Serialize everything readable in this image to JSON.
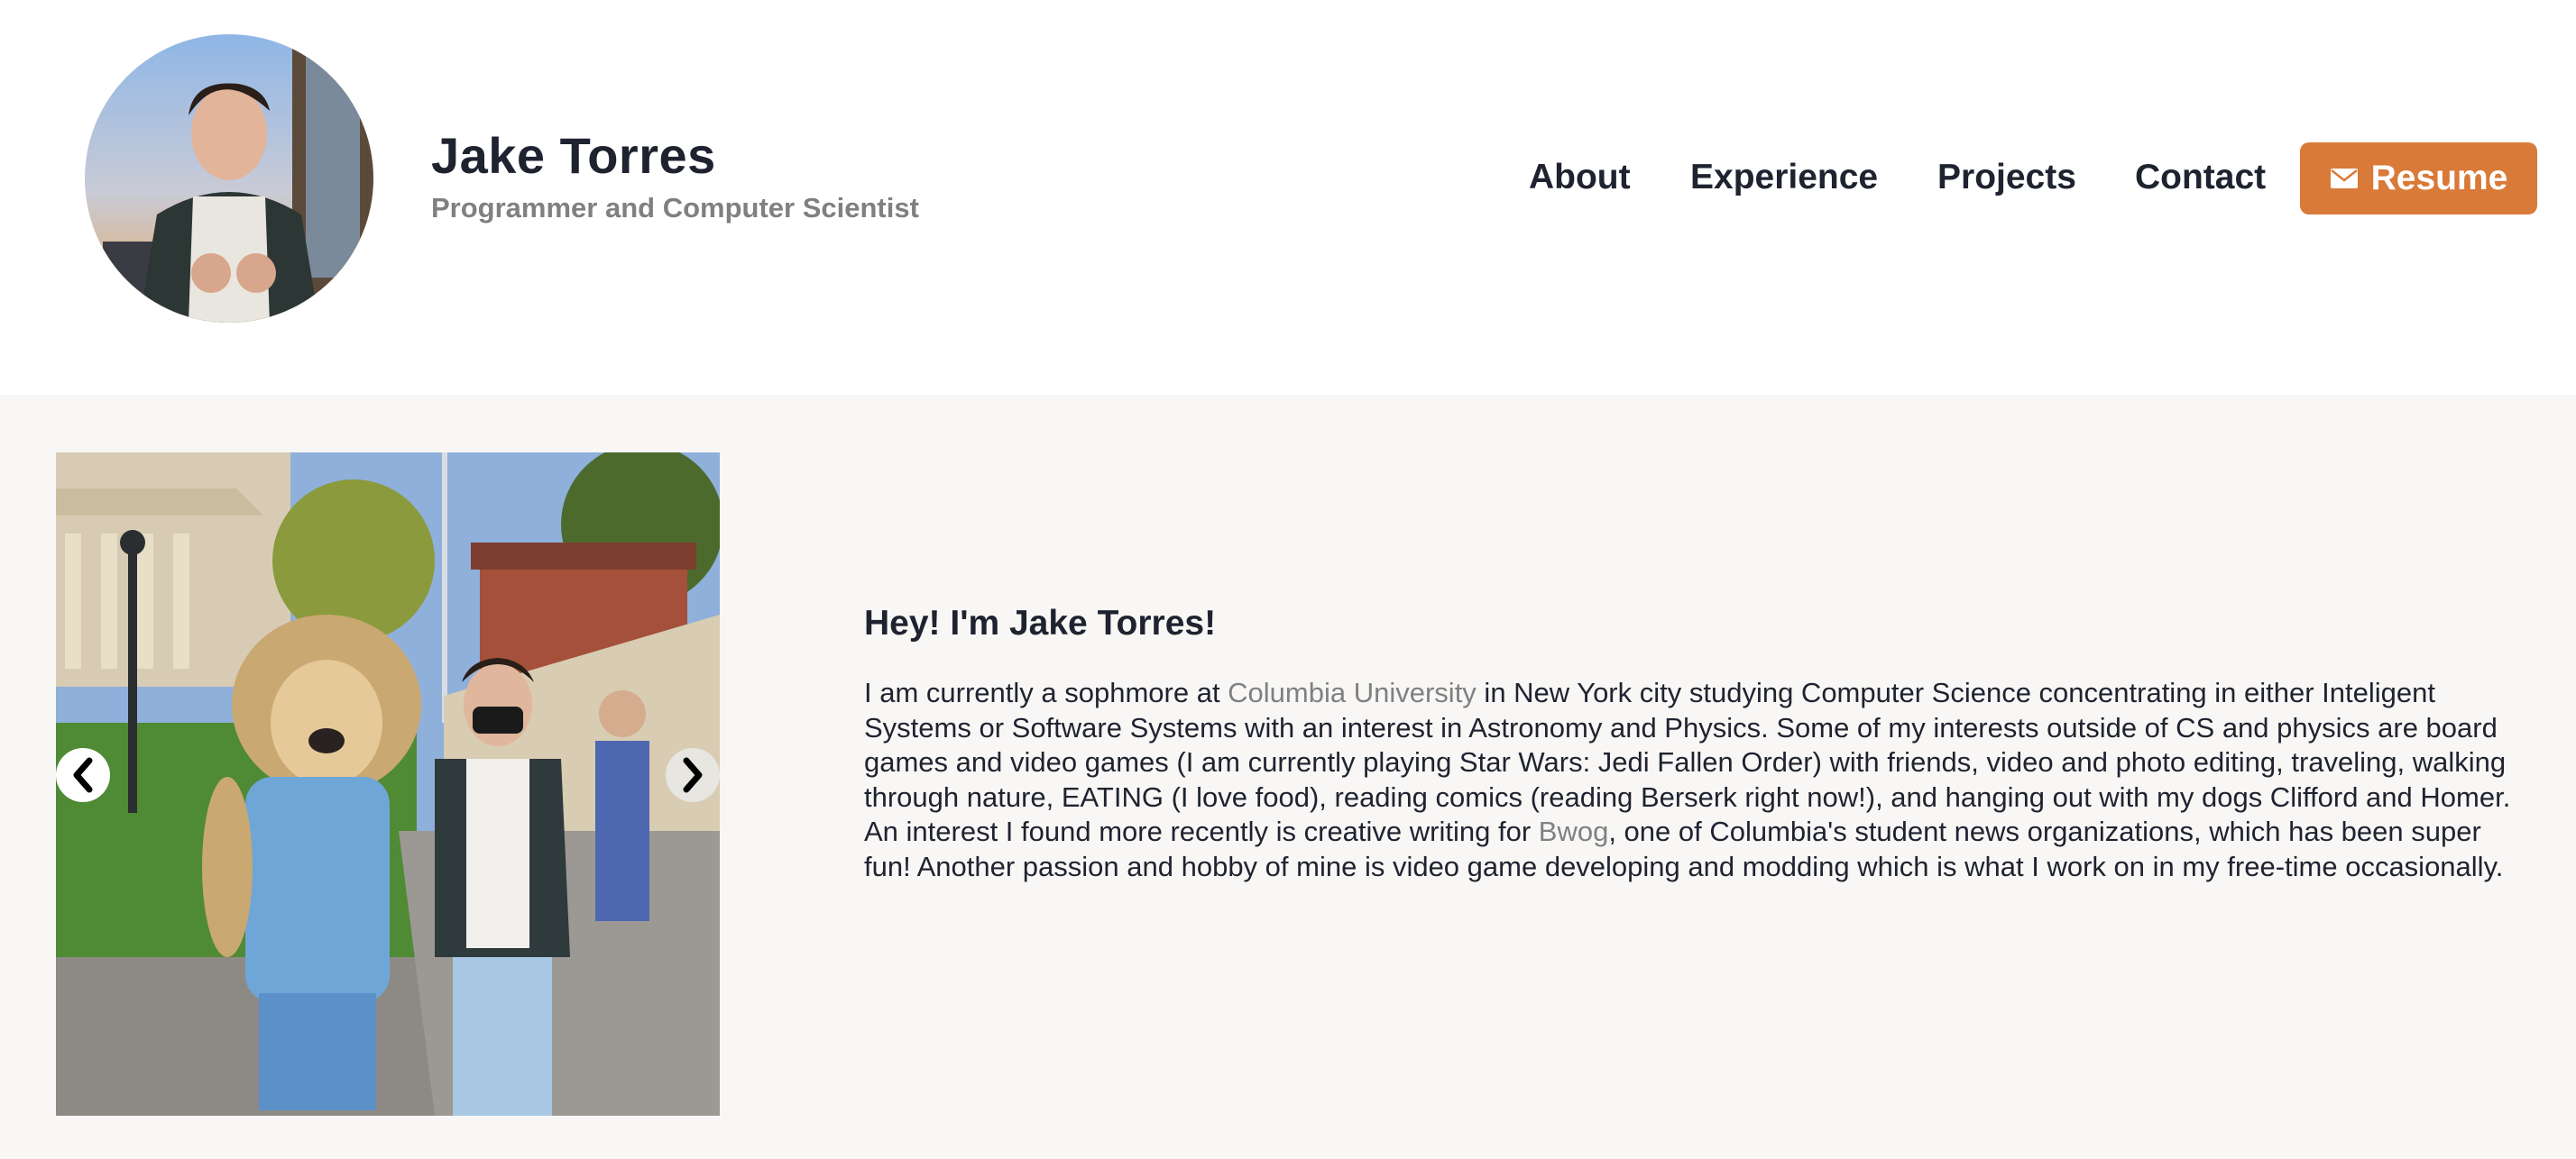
{
  "header": {
    "name": "Jake Torres",
    "tagline": "Programmer and Computer Scientist",
    "avatar_alt": "Profile photo"
  },
  "nav": {
    "about": "About",
    "experience": "Experience",
    "projects": "Projects",
    "contact": "Contact",
    "resume": "Resume",
    "resume_icon": "envelope-icon"
  },
  "colors": {
    "accent": "#d97a38",
    "link_gray": "#808080",
    "text_dark": "#1f2330",
    "section_bg": "#f8f7f5"
  },
  "carousel": {
    "prev_icon": "chevron-left-icon",
    "next_icon": "chevron-right-icon"
  },
  "intro": {
    "title": "Hey! I'm Jake Torres!",
    "p1": "I am currently a sophmore at ",
    "link1": "Columbia University",
    "p2": " in New York city studying Computer Science concentrating in either Inteligent Systems or Software Systems with an interest in Astronomy and Physics. Some of my interests outside of CS and physics are board games and video games (I am currently playing Star Wars: Jedi Fallen Order) with friends, video and photo editing, traveling, walking through nature, EATING (I love food), reading comics (reading Berserk right now!), and hanging out with my dogs Clifford and Homer. An interest I found more recently is creative writing for ",
    "link2": "Bwog",
    "p3": ", one of Columbia's student news organizations, which has been super fun! Another passion and hobby of mine is video game developing and modding which is what I work on in my free-time occasionally."
  }
}
